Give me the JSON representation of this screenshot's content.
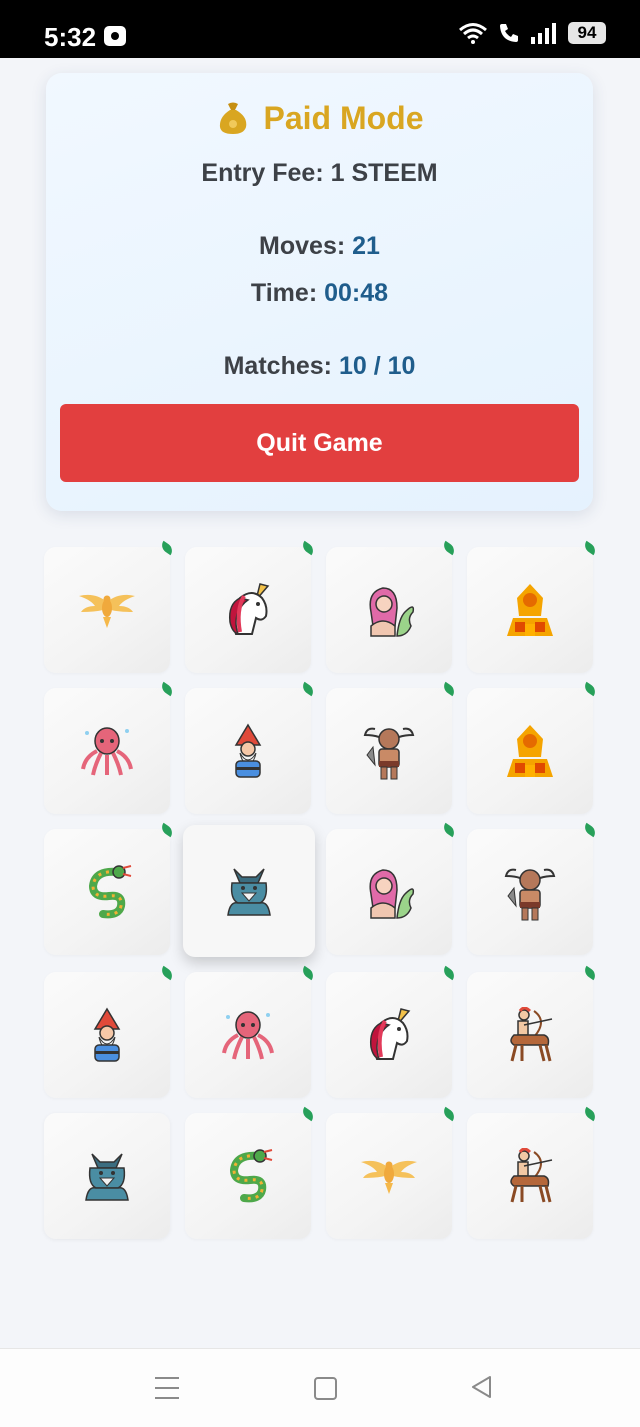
{
  "status_bar": {
    "time": "5:32",
    "battery": "94",
    "icons": [
      "media-icon",
      "wifi-icon",
      "call-icon",
      "signal-icon",
      "battery-icon"
    ]
  },
  "game": {
    "mode_title": "Paid Mode",
    "mode_icon": "moneybag-icon",
    "entry_fee": "Entry Fee: 1 STEEM",
    "moves_label": "Moves:",
    "moves_value": "21",
    "time_label": "Time:",
    "time_value": "00:48",
    "matches_label": "Matches:",
    "matches_value": "10 / 10",
    "quit_label": "Quit Game"
  },
  "board": {
    "rows": 5,
    "columns": 4,
    "cards": [
      {
        "creature": "phoenix",
        "matched": true
      },
      {
        "creature": "unicorn",
        "matched": true
      },
      {
        "creature": "mermaid",
        "matched": true
      },
      {
        "creature": "sphinx",
        "matched": true
      },
      {
        "creature": "kraken",
        "matched": true
      },
      {
        "creature": "gnome",
        "matched": true
      },
      {
        "creature": "minotaur",
        "matched": true
      },
      {
        "creature": "sphinx",
        "matched": true
      },
      {
        "creature": "dragon",
        "matched": true
      },
      {
        "creature": "werewolf",
        "matched": false
      },
      {
        "creature": "mermaid",
        "matched": true
      },
      {
        "creature": "minotaur",
        "matched": true
      },
      {
        "creature": "gnome",
        "matched": true
      },
      {
        "creature": "kraken",
        "matched": true
      },
      {
        "creature": "unicorn",
        "matched": true
      },
      {
        "creature": "centaur",
        "matched": true
      },
      {
        "creature": "werewolf",
        "matched": false
      },
      {
        "creature": "dragon",
        "matched": true
      },
      {
        "creature": "phoenix",
        "matched": true
      },
      {
        "creature": "centaur",
        "matched": true
      }
    ]
  },
  "colors": {
    "accent_gold": "#d9a621",
    "value_blue": "#1f5d8c",
    "quit_red": "#e23f3f",
    "match_green": "#27a05a"
  },
  "nav_bar": {
    "icons": [
      "menu-icon",
      "home-icon",
      "back-icon"
    ]
  }
}
